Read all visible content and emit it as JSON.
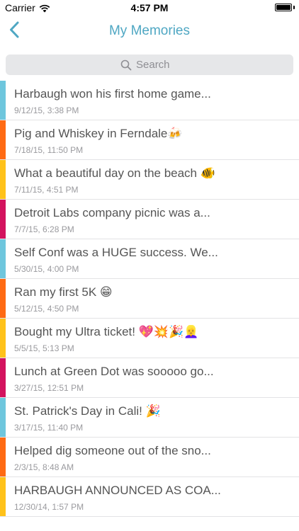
{
  "status_bar": {
    "carrier": "Carrier",
    "time": "4:57 PM",
    "battery_level": 1.0
  },
  "nav": {
    "title": "My Memories",
    "back_icon": "chevron-left-icon",
    "accent_color": "#4fa7c3"
  },
  "search": {
    "placeholder": "Search",
    "value": ""
  },
  "stripe_colors": {
    "blue": "#6ec6dd",
    "orange": "#ff6a13",
    "yellow": "#ffc21a",
    "magenta": "#d3135e"
  },
  "memories": [
    {
      "title": "Harbaugh won his first home game...",
      "date": "9/12/15, 3:38 PM",
      "color": "#6ec6dd"
    },
    {
      "title": "Pig and Whiskey in Ferndale🍻",
      "date": "7/18/15, 11:50 PM",
      "color": "#ff6a13"
    },
    {
      "title": "What a beautiful day on the beach 🐠",
      "date": "7/11/15, 4:51 PM",
      "color": "#ffc21a"
    },
    {
      "title": "Detroit Labs company picnic was a...",
      "date": "7/7/15, 6:28 PM",
      "color": "#d3135e"
    },
    {
      "title": "Self Conf was a HUGE success. We...",
      "date": "5/30/15, 4:00 PM",
      "color": "#6ec6dd"
    },
    {
      "title": "Ran my first 5K 😁",
      "date": "5/12/15, 4:50 PM",
      "color": "#ff6a13"
    },
    {
      "title": "Bought my Ultra ticket! 💖💥🎉👱‍♀️",
      "date": "5/5/15, 5:13 PM",
      "color": "#ffc21a"
    },
    {
      "title": "Lunch at Green Dot was sooooo go...",
      "date": "3/27/15, 12:51 PM",
      "color": "#d3135e"
    },
    {
      "title": "St. Patrick's Day in Cali! 🎉",
      "date": "3/17/15, 11:40 PM",
      "color": "#6ec6dd"
    },
    {
      "title": "Helped dig someone out of the sno...",
      "date": "2/3/15, 8:48 AM",
      "color": "#ff6a13"
    },
    {
      "title": "HARBAUGH ANNOUNCED AS COA...",
      "date": "12/30/14, 1:57 PM",
      "color": "#ffc21a"
    }
  ]
}
